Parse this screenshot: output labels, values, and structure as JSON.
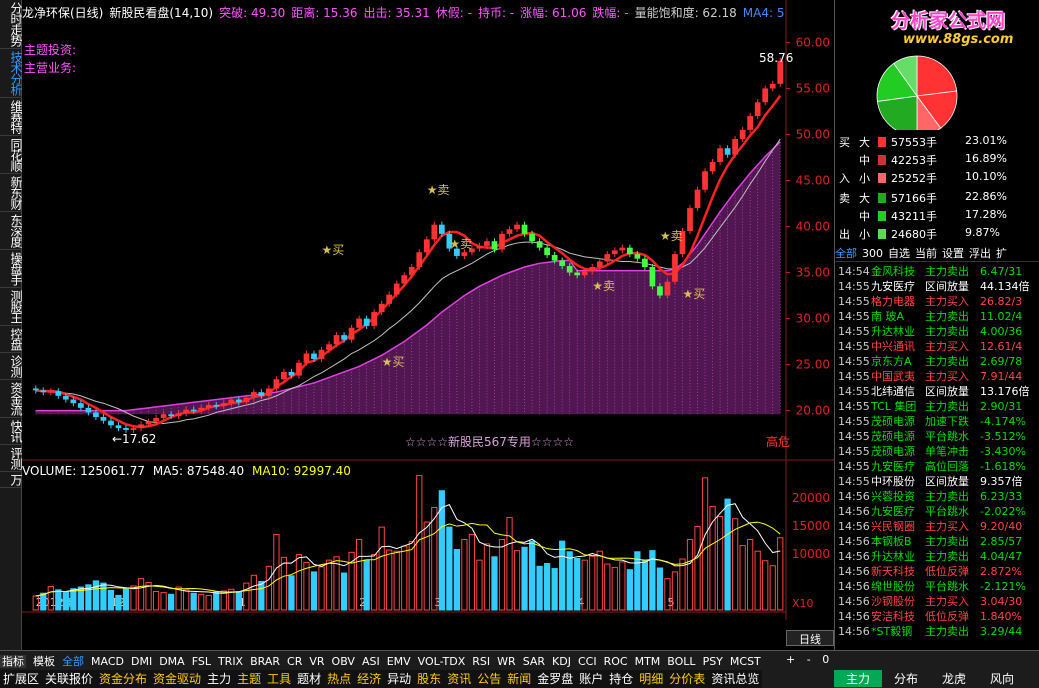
{
  "header": {
    "title": "龙净环保(日线)",
    "indicator": "新股民看盘(14,10)",
    "items": [
      {
        "label": "突破: 49.30",
        "color": "#ff55ff"
      },
      {
        "label": "距离: 15.36",
        "color": "#ff55ff"
      },
      {
        "label": "出击: 35.31",
        "color": "#ff55ff"
      },
      {
        "label": "休假: -",
        "color": "#ff55ff"
      },
      {
        "label": "持币: -",
        "color": "#ff55ff"
      },
      {
        "label": "涨幅: 61.06",
        "color": "#ff55ff"
      },
      {
        "label": "跌幅: -",
        "color": "#ff55ff"
      },
      {
        "label": "量能饱和度: 62.18",
        "color": "#cccccc"
      },
      {
        "label": "MA4: 5",
        "color": "#4488ff"
      }
    ],
    "tags": [
      "主题投资:",
      "主营业务:"
    ]
  },
  "chart_data": [
    {
      "type": "candlestick",
      "title": "龙净环保(日线)",
      "watermark": "☆☆☆☆新股民567专用☆☆☆☆",
      "ylim": [
        15.5,
        62
      ],
      "yticks": [
        60,
        55,
        50,
        45,
        40,
        35,
        30,
        25,
        20
      ],
      "xlabels": [
        "2012年",
        "12",
        "1",
        "2",
        "3",
        "4",
        "5"
      ],
      "annotations": [
        {
          "text": "58.76",
          "type": "high"
        },
        {
          "text": "17.62",
          "type": "low"
        },
        {
          "text": "高危",
          "type": "label"
        }
      ],
      "signals": [
        "卖",
        "卖",
        "卖",
        "买",
        "卖",
        "买",
        "买"
      ],
      "close": [
        22.2,
        22.0,
        22.1,
        21.6,
        21.2,
        20.8,
        20.3,
        19.8,
        19.3,
        18.9,
        18.4,
        18.1,
        17.9,
        18.1,
        18.5,
        18.8,
        19.2,
        19.6,
        19.4,
        19.7,
        20.1,
        20.0,
        20.3,
        20.6,
        20.5,
        20.8,
        21.2,
        20.9,
        21.4,
        22.0,
        21.6,
        22.4,
        23.4,
        24.2,
        23.8,
        25.2,
        26.2,
        25.6,
        26.6,
        27.2,
        28.2,
        27.7,
        29.0,
        30.0,
        29.2,
        30.7,
        31.6,
        32.6,
        33.8,
        34.7,
        35.6,
        37.2,
        38.6,
        40.2,
        39.2,
        37.6,
        36.8,
        37.2,
        37.6,
        37.9,
        38.4,
        37.5,
        39.2,
        39.7,
        40.2,
        39.2,
        38.4,
        37.7,
        36.9,
        36.3,
        35.7,
        35.0,
        34.7,
        35.1,
        35.6,
        36.2,
        37.0,
        37.4,
        37.7,
        37.0,
        36.5,
        35.6,
        33.5,
        32.5,
        34.0,
        37.0,
        39.5,
        42.0,
        44.0,
        46.0,
        47.0,
        48.5,
        47.8,
        49.5,
        50.5,
        52.0,
        53.5,
        55.0,
        55.5,
        58.0
      ],
      "ma5": [
        22.2,
        22.1,
        22.1,
        22.0,
        21.8,
        21.5,
        21.2,
        20.7,
        20.3,
        19.8,
        19.3,
        18.9,
        18.5,
        18.3,
        18.2,
        18.3,
        18.5,
        18.9,
        19.3,
        19.6,
        19.8,
        19.8,
        20.0,
        20.3,
        20.5,
        20.6,
        20.8,
        20.9,
        21.1,
        21.5,
        21.6,
        21.9,
        22.6,
        23.1,
        23.7,
        24.2,
        25.2,
        25.4,
        25.9,
        26.5,
        27.1,
        27.6,
        28.3,
        28.8,
        29.4,
        30.1,
        30.9,
        31.8,
        32.7,
        33.6,
        34.6,
        35.7,
        36.8,
        38.0,
        39.0,
        39.4,
        39.4,
        39.0,
        38.2,
        37.8,
        37.7,
        37.7,
        38.2,
        38.6,
        39.0,
        39.2,
        39.3,
        39.0,
        38.3,
        37.7,
        37.1,
        36.4,
        35.8,
        35.4,
        35.3,
        35.5,
        35.8,
        36.3,
        36.8,
        37.1,
        37.1,
        36.9,
        36.3,
        35.4,
        34.8,
        34.9,
        35.8,
        37.1,
        39.0,
        41.1,
        43.2,
        45.1,
        46.6,
        47.8,
        48.8,
        49.9,
        50.8,
        52.1,
        53.1,
        54.2
      ],
      "ma10": [
        22.2,
        22.2,
        22.2,
        22.1,
        21.9,
        21.8,
        21.6,
        21.3,
        21.0,
        20.8,
        20.5,
        20.2,
        19.8,
        19.4,
        19.1,
        18.8,
        18.7,
        18.6,
        18.7,
        18.8,
        19.0,
        19.1,
        19.3,
        19.5,
        19.8,
        20.0,
        20.2,
        20.4,
        20.6,
        20.8,
        21.1,
        21.3,
        21.6,
        22.0,
        22.4,
        22.7,
        23.2,
        23.7,
        24.1,
        24.6,
        25.1,
        25.6,
        26.2,
        26.6,
        27.1,
        27.6,
        28.2,
        28.9,
        29.5,
        30.2,
        30.9,
        31.7,
        32.6,
        33.5,
        34.3,
        34.8,
        35.2,
        35.6,
        36.0,
        36.5,
        37.0,
        37.4,
        37.7,
        38.0,
        38.2,
        38.3,
        38.3,
        38.2,
        38.0,
        37.8,
        37.5,
        37.1,
        36.9,
        36.7,
        36.6,
        36.5,
        36.4,
        36.3,
        36.2,
        36.2,
        36.1,
        36.0,
        35.8,
        35.6,
        35.4,
        35.4,
        35.6,
        36.0,
        36.8,
        37.7,
        38.8,
        39.9,
        41.0,
        42.1,
        43.3,
        44.6,
        45.8,
        47.1,
        48.3,
        49.5
      ],
      "chip": [
        20.0,
        20.0,
        20.0,
        20.0,
        20.0,
        20.0,
        20.0,
        20.0,
        20.0,
        20.0,
        20.0,
        20.0,
        20.0,
        20.1,
        20.2,
        20.3,
        20.4,
        20.5,
        20.6,
        20.7,
        20.8,
        20.9,
        21.0,
        21.1,
        21.2,
        21.3,
        21.4,
        21.5,
        21.6,
        21.7,
        21.8,
        21.9,
        22.0,
        22.2,
        22.4,
        22.6,
        22.8,
        23.0,
        23.3,
        23.6,
        23.9,
        24.2,
        24.5,
        24.8,
        25.2,
        25.6,
        26.0,
        26.5,
        27.0,
        27.5,
        28.1,
        28.7,
        29.3,
        30.0,
        30.7,
        31.3,
        31.9,
        32.5,
        33.0,
        33.5,
        33.9,
        34.3,
        34.7,
        35.0,
        35.3,
        35.6,
        35.8,
        36.0,
        36.1,
        36.2,
        36.3,
        36.3,
        35.2,
        35.2,
        35.2,
        35.2,
        35.2,
        35.2,
        35.2,
        35.2,
        35.2,
        35.2,
        35.2,
        35.2,
        35.2,
        35.4,
        36.0,
        37.0,
        38.0,
        39.2,
        40.4,
        41.6,
        42.7,
        43.8,
        44.8,
        45.8,
        46.7,
        47.6,
        48.4,
        49.2
      ]
    },
    {
      "type": "bar",
      "title": "VOLUME",
      "ylim": [
        0,
        25000
      ],
      "yticks": [
        20000,
        15000,
        10000
      ],
      "scale_label": "X10",
      "values": [
        2500,
        3000,
        4200,
        3600,
        3200,
        3800,
        4100,
        4500,
        5200,
        4800,
        3500,
        2600,
        3800,
        4300,
        5600,
        4900,
        3300,
        3100,
        2800,
        4100,
        3600,
        3000,
        2800,
        2600,
        3200,
        3400,
        3700,
        3300,
        4800,
        6200,
        5100,
        7800,
        13500,
        9400,
        6100,
        9900,
        8500,
        6800,
        7700,
        8900,
        9500,
        6600,
        10300,
        12600,
        8900,
        9900,
        14800,
        10700,
        10500,
        11400,
        12200,
        24000,
        15700,
        18300,
        21300,
        14800,
        10800,
        12600,
        13500,
        8900,
        11800,
        9500,
        12600,
        16500,
        10600,
        11200,
        12300,
        7800,
        8300,
        7400,
        12300,
        10400,
        9200,
        8900,
        9600,
        10500,
        8200,
        7600,
        8600,
        7200,
        10400,
        8900,
        10600,
        7500,
        5600,
        6800,
        9100,
        12600,
        14900,
        23600,
        18500,
        16700,
        19800,
        16300,
        11500,
        12600,
        10500,
        8800,
        7900,
        12900
      ]
    }
  ],
  "volume_header": {
    "volume": "VOLUME: 125061.77",
    "ma5": "MA5: 87548.40",
    "ma10": "MA10: 92997.40"
  },
  "left_nav": [
    "分时走势",
    "技术分析",
    "维赛特",
    "同花顺",
    "新东财",
    "东深度",
    "操盘手",
    "测股王",
    "控盘",
    "诊测",
    "资金流",
    "快讯",
    "评测",
    "万"
  ],
  "right_panel": {
    "logo_title": "分析家公式网",
    "logo_url": "www.88gs.com",
    "pie": [
      {
        "value": 23.01,
        "color": "#ff3333"
      },
      {
        "value": 16.89,
        "color": "#ff3333"
      },
      {
        "value": 10.1,
        "color": "#ff6666"
      },
      {
        "value": 22.86,
        "color": "#22aa22"
      },
      {
        "value": 17.28,
        "color": "#22cc22"
      },
      {
        "value": 9.87,
        "color": "#66dd66"
      }
    ],
    "buy_label": "买",
    "in_label": "入",
    "sell_label": "卖",
    "out_label": "出",
    "buy": [
      {
        "size": "大",
        "amount": "57553手",
        "pct": "23.01%",
        "color": "#ff3333"
      },
      {
        "size": "中",
        "amount": "42253手",
        "pct": "16.89%",
        "color": "#cc3333"
      },
      {
        "size": "小",
        "amount": "25252手",
        "pct": "10.10%",
        "color": "#ff6666"
      }
    ],
    "sell": [
      {
        "size": "大",
        "amount": "57166手",
        "pct": "22.86%",
        "color": "#22aa22"
      },
      {
        "size": "中",
        "amount": "43211手",
        "pct": "17.28%",
        "color": "#22cc22"
      },
      {
        "size": "小",
        "amount": "24680手",
        "pct": "9.87%",
        "color": "#55dd55"
      }
    ],
    "tabs": [
      "全部",
      "300",
      "自选",
      "当前",
      "设置",
      "浮出",
      "扩"
    ],
    "ticker": [
      {
        "time": "14:54",
        "name": "金风科技",
        "event": "主力卖出",
        "value": "6.47/31",
        "c": "#00dd00"
      },
      {
        "time": "14:55",
        "name": "九安医疗",
        "event": "区间放量",
        "value": "44.134倍",
        "c": "#ffffff"
      },
      {
        "time": "14:55",
        "name": "格力电器",
        "event": "主力买入",
        "value": "26.82/3",
        "c": "#ff4444"
      },
      {
        "time": "14:55",
        "name": "南  玻A",
        "event": "主力卖出",
        "value": "11.02/4",
        "c": "#00dd00"
      },
      {
        "time": "14:55",
        "name": "升达林业",
        "event": "主力卖出",
        "value": "4.00/36",
        "c": "#00dd00"
      },
      {
        "time": "14:55",
        "name": "中兴通讯",
        "event": "主力买入",
        "value": "12.61/4",
        "c": "#ff4444"
      },
      {
        "time": "14:55",
        "name": "京东方A",
        "event": "主力卖出",
        "value": "2.69/78",
        "c": "#00dd00"
      },
      {
        "time": "14:55",
        "name": "中国武夷",
        "event": "主力买入",
        "value": "7.91/44",
        "c": "#ff4444"
      },
      {
        "time": "14:55",
        "name": "北纬通信",
        "event": "区间放量",
        "value": "13.176倍",
        "c": "#ffffff"
      },
      {
        "time": "14:55",
        "name": "TCL 集团",
        "event": "主力卖出",
        "value": "2.90/31",
        "c": "#00dd00"
      },
      {
        "time": "14:55",
        "name": "茂硕电源",
        "event": "加速下跌",
        "value": "-4.174%",
        "c": "#00dd00"
      },
      {
        "time": "14:55",
        "name": "茂硕电源",
        "event": "平台跳水",
        "value": "-3.512%",
        "c": "#00dd00"
      },
      {
        "time": "14:55",
        "name": "茂硕电源",
        "event": "单笔冲击",
        "value": "-3.430%",
        "c": "#00dd00"
      },
      {
        "time": "14:55",
        "name": "九安医疗",
        "event": "高位回落",
        "value": "-1.618%",
        "c": "#00dd00"
      },
      {
        "time": "14:55",
        "name": "中环股份",
        "event": "区间放量",
        "value": "9.357倍",
        "c": "#ffffff"
      },
      {
        "time": "14:56",
        "name": "兴蓉投资",
        "event": "主力卖出",
        "value": "6.23/33",
        "c": "#00dd00"
      },
      {
        "time": "14:56",
        "name": "九安医疗",
        "event": "平台跳水",
        "value": "-2.022%",
        "c": "#00dd00"
      },
      {
        "time": "14:56",
        "name": "兴民钢圈",
        "event": "主力买入",
        "value": "9.20/40",
        "c": "#ff4444"
      },
      {
        "time": "14:56",
        "name": "本钢板B",
        "event": "主力卖出",
        "value": "2.85/57",
        "c": "#00dd00"
      },
      {
        "time": "14:56",
        "name": "升达林业",
        "event": "主力卖出",
        "value": "4.04/47",
        "c": "#00dd00"
      },
      {
        "time": "14:56",
        "name": "新天科技",
        "event": "低位反弹",
        "value": "2.872%",
        "c": "#ff4444"
      },
      {
        "time": "14:56",
        "name": "绵世股份",
        "event": "平台跳水",
        "value": "-2.121%",
        "c": "#00dd00"
      },
      {
        "time": "14:56",
        "name": "沙钢股份",
        "event": "主力买入",
        "value": "3.04/30",
        "c": "#ff4444"
      },
      {
        "time": "14:56",
        "name": "安洁科技",
        "event": "低位反弹",
        "value": "1.840%",
        "c": "#ff4444"
      },
      {
        "time": "14:56",
        "name": "*ST毅钢",
        "event": "主力卖出",
        "value": "3.29/44",
        "c": "#00dd00"
      }
    ]
  },
  "indicators": [
    "指标",
    "模板",
    "全部",
    "MACD",
    "DMI",
    "DMA",
    "FSL",
    "TRIX",
    "BRAR",
    "CR",
    "VR",
    "OBV",
    "ASI",
    "EMV",
    "VOL-TDX",
    "RSI",
    "WR",
    "SAR",
    "KDJ",
    "CCI",
    "ROC",
    "MTM",
    "BOLL",
    "PSY",
    "MCST"
  ],
  "menu": [
    {
      "t": "扩展区",
      "c": "#ffffff"
    },
    {
      "t": "关联报价",
      "c": "#ffffff"
    },
    {
      "t": "资金分布",
      "c": "#ffcc00"
    },
    {
      "t": "资金驱动",
      "c": "#ffcc00"
    },
    {
      "t": "主力",
      "c": "#ffffff"
    },
    {
      "t": "主题",
      "c": "#ffcc00"
    },
    {
      "t": "工具",
      "c": "#ffcc00"
    },
    {
      "t": "题材",
      "c": "#ffffff"
    },
    {
      "t": "热点",
      "c": "#ffcc00"
    },
    {
      "t": "经济",
      "c": "#ffcc00"
    },
    {
      "t": "异动",
      "c": "#ffffff"
    },
    {
      "t": "股东",
      "c": "#ffcc00"
    },
    {
      "t": "资讯",
      "c": "#ffcc00"
    },
    {
      "t": "公告",
      "c": "#ffcc00"
    },
    {
      "t": "新闻",
      "c": "#ffcc00"
    },
    {
      "t": "金罗盘",
      "c": "#ffffff"
    },
    {
      "t": "账户",
      "c": "#ffffff"
    },
    {
      "t": "持仓",
      "c": "#ffffff"
    },
    {
      "t": "明细",
      "c": "#ffcc00"
    },
    {
      "t": "分价表",
      "c": "#ffcc00"
    },
    {
      "t": "资讯总览",
      "c": "#ffffff"
    }
  ],
  "right_tabs": [
    "主力",
    "分布",
    "龙虎",
    "风向"
  ],
  "period_button": "日线",
  "zoom": [
    "+",
    "-",
    "0"
  ]
}
